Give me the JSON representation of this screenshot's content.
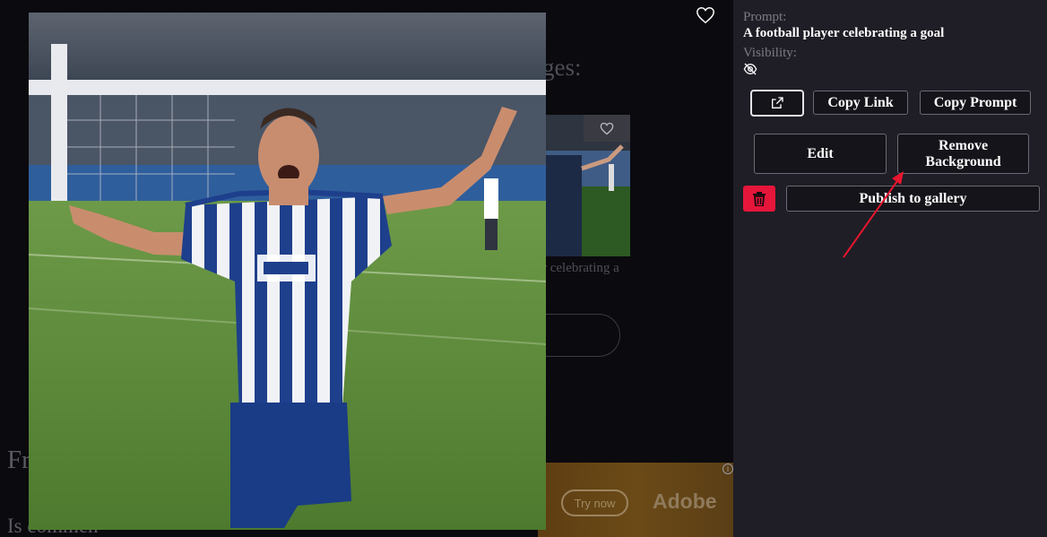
{
  "background_page": {
    "heading_fragment": "ges:",
    "caption_fragment": "r celebrating a",
    "text_fr": "Fr",
    "text_is": "Is commen"
  },
  "ad": {
    "try_now_label": "Try now",
    "brand": "Adobe",
    "info_glyph": "i"
  },
  "panel": {
    "prompt_label": "Prompt:",
    "prompt_value": "A football player celebrating a goal",
    "visibility_label": "Visibility:",
    "visibility_icon": "eye-off-icon",
    "buttons": {
      "open_external_icon": "external-link-icon",
      "copy_link": "Copy Link",
      "copy_prompt": "Copy Prompt",
      "edit": "Edit",
      "remove_background": "Remove Background",
      "delete_icon": "trash-icon",
      "publish": "Publish to gallery"
    }
  },
  "colors": {
    "panel_bg": "#1f1e26",
    "delete_red": "#e6163b",
    "annotation_arrow": "#e8152e"
  }
}
